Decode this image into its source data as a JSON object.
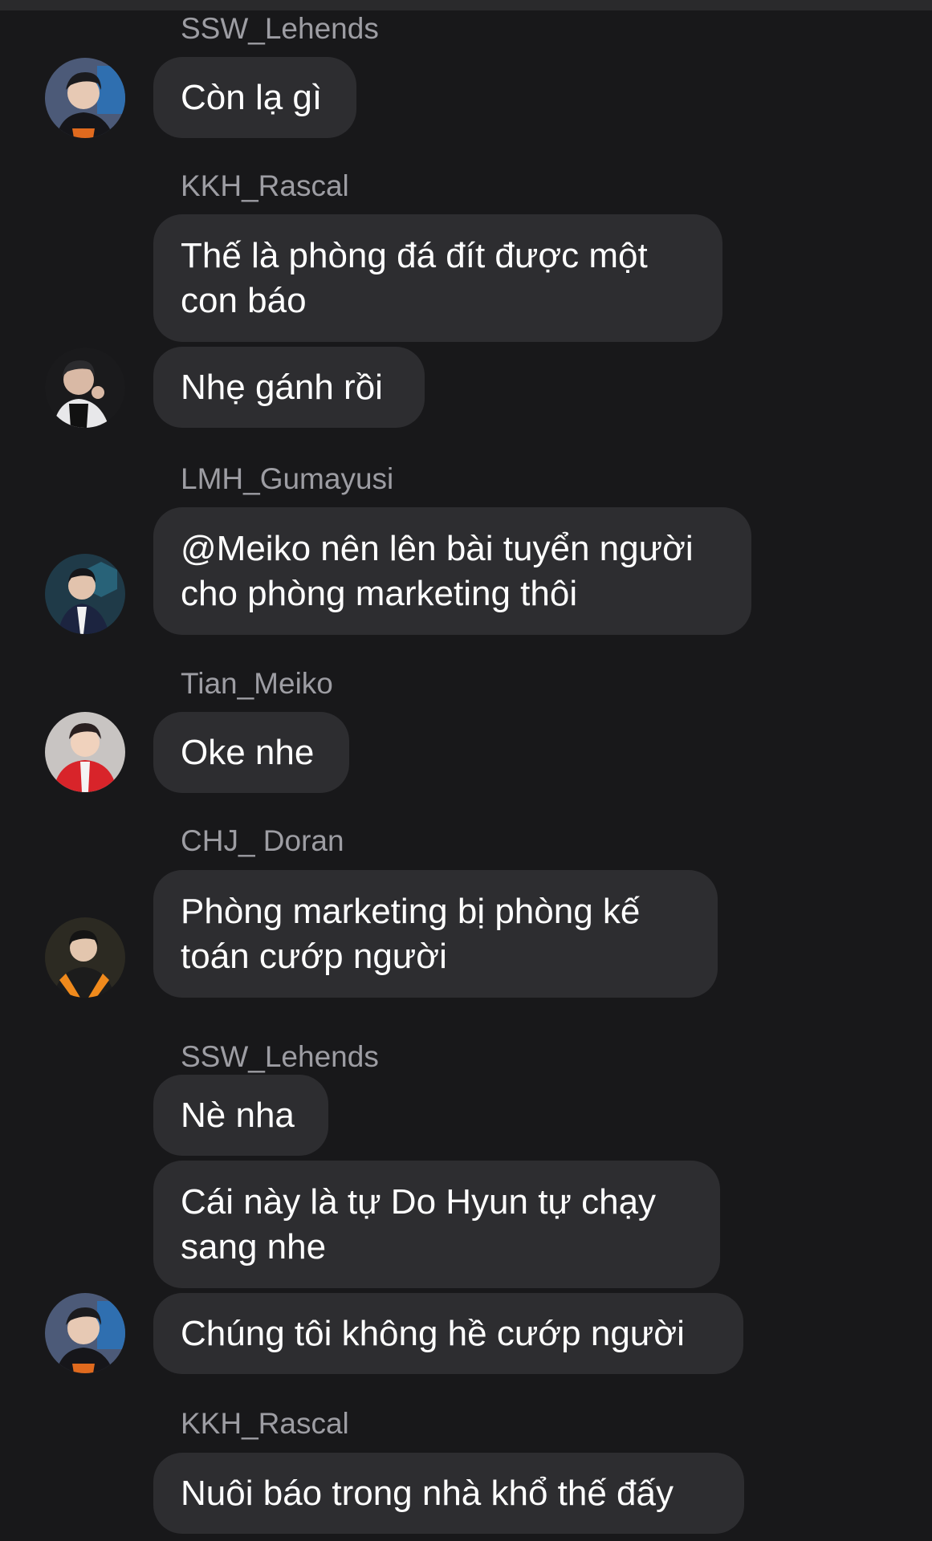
{
  "messages": [
    {
      "sender": "SSW_Lehends",
      "bubbles": [
        "Còn lạ gì"
      ]
    },
    {
      "sender": "KKH_Rascal",
      "bubbles": [
        "Thế là phòng đá đít được một con báo",
        "Nhẹ gánh rồi"
      ]
    },
    {
      "sender": "LMH_Gumayusi",
      "bubbles": [
        "@Meiko nên lên bài tuyển người cho phòng marketing thôi"
      ]
    },
    {
      "sender": "Tian_Meiko",
      "bubbles": [
        "Oke nhe"
      ]
    },
    {
      "sender": "CHJ_ Doran",
      "bubbles": [
        "Phòng marketing bị phòng kế toán cướp người"
      ]
    },
    {
      "sender": "SSW_Lehends",
      "bubbles": [
        "Nè nha",
        "Cái này là tự Do Hyun tự chạy sang nhe",
        "Chúng tôi không hề cướp người"
      ]
    },
    {
      "sender": "KKH_Rascal",
      "bubbles": [
        "Nuôi báo trong nhà khổ thế đấy"
      ]
    }
  ],
  "colors": {
    "background": "#18181a",
    "bubble": "#2d2d30",
    "sender_name": "#9d9da3",
    "message_text": "#ffffff"
  }
}
